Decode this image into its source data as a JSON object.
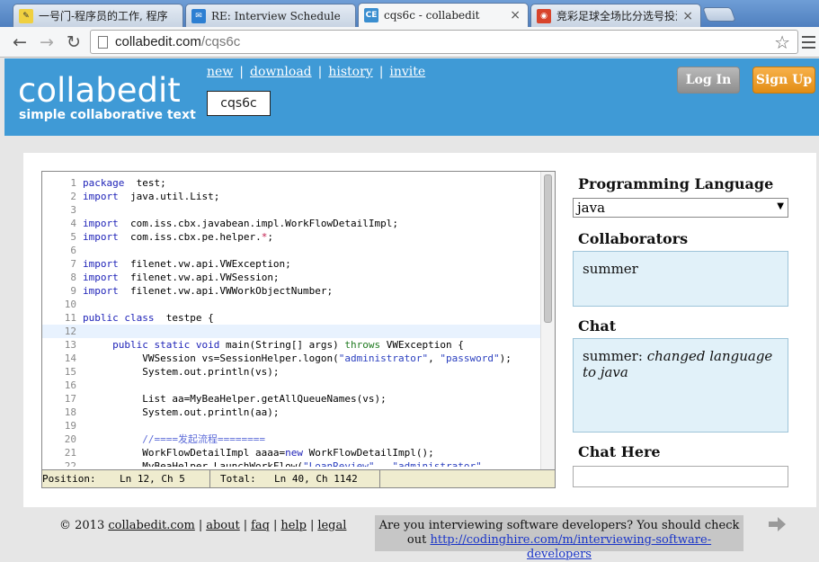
{
  "browser": {
    "tabs": [
      {
        "title": "一号门-程序员的工作, 程序",
        "active": false,
        "favicon": "edit-icon"
      },
      {
        "title": "RE: Interview Schedule",
        "active": false,
        "favicon": "mail-icon"
      },
      {
        "title": "cqs6c - collabedit",
        "active": true,
        "favicon": "CE"
      },
      {
        "title": "竞彩足球全场比分选号投注",
        "active": false,
        "favicon": "lottery-icon"
      }
    ],
    "tab_close_glyph": "×",
    "url_host": "collabedit.com",
    "url_path": "/cqs6c",
    "back_glyph": "←",
    "forward_glyph": "→",
    "reload_glyph": "↻",
    "star_glyph": "☆"
  },
  "site": {
    "logo": "collabedit",
    "tagline": "simple collaborative text",
    "nav": {
      "new": "new",
      "download": "download",
      "history": "history",
      "invite": "invite"
    },
    "nav_sep": "|",
    "doc_id": "cqs6c",
    "login": "Log In",
    "signup": "Sign Up"
  },
  "editor": {
    "status": {
      "position_label": "Position:",
      "position": "Ln 12, Ch 5",
      "total_label": "Total:",
      "total": "Ln 40, Ch 1142"
    },
    "highlighted_line": 12,
    "lines": [
      {
        "n": "1",
        "parts": [
          [
            "k",
            "package"
          ],
          [
            "",
            "  test;"
          ]
        ]
      },
      {
        "n": "2",
        "parts": [
          [
            "k",
            "import"
          ],
          [
            "",
            "  java.util.List;"
          ]
        ]
      },
      {
        "n": "3",
        "parts": []
      },
      {
        "n": "4",
        "parts": [
          [
            "k",
            "import"
          ],
          [
            "",
            "  com.iss.cbx.javabean.impl.WorkFlowDetailImpl;"
          ]
        ]
      },
      {
        "n": "5",
        "parts": [
          [
            "k",
            "import"
          ],
          [
            "",
            "  com.iss.cbx.pe.helper."
          ],
          [
            "o",
            "*"
          ],
          [
            "",
            ";"
          ]
        ]
      },
      {
        "n": "6",
        "parts": []
      },
      {
        "n": "7",
        "parts": [
          [
            "k",
            "import"
          ],
          [
            "",
            "  filenet.vw.api.VWException;"
          ]
        ]
      },
      {
        "n": "8",
        "parts": [
          [
            "k",
            "import"
          ],
          [
            "",
            "  filenet.vw.api.VWSession;"
          ]
        ]
      },
      {
        "n": "9",
        "parts": [
          [
            "k",
            "import"
          ],
          [
            "",
            "  filenet.vw.api.VWWorkObjectNumber;"
          ]
        ]
      },
      {
        "n": "10",
        "parts": []
      },
      {
        "n": "11",
        "parts": [
          [
            "k",
            "public class"
          ],
          [
            "",
            "  testpe {"
          ]
        ]
      },
      {
        "n": "12",
        "parts": [
          [
            "",
            "    "
          ]
        ]
      },
      {
        "n": "13",
        "parts": [
          [
            "",
            "     "
          ],
          [
            "k",
            "public static void"
          ],
          [
            "",
            " main(String[] args) "
          ],
          [
            "t",
            "throws"
          ],
          [
            "",
            " VWException {"
          ]
        ]
      },
      {
        "n": "14",
        "parts": [
          [
            "",
            "          VWSession vs=SessionHelper.logon("
          ],
          [
            "s",
            "\"administrator\""
          ],
          [
            "",
            ", "
          ],
          [
            "s",
            "\"password\""
          ],
          [
            "",
            ");"
          ]
        ]
      },
      {
        "n": "15",
        "parts": [
          [
            "",
            "          System.out.println(vs);"
          ]
        ]
      },
      {
        "n": "16",
        "parts": []
      },
      {
        "n": "17",
        "parts": [
          [
            "",
            "          List aa=MyBeaHelper.getAllQueueNames(vs);"
          ]
        ]
      },
      {
        "n": "18",
        "parts": [
          [
            "",
            "          System.out.println(aa);"
          ]
        ]
      },
      {
        "n": "19",
        "parts": []
      },
      {
        "n": "20",
        "parts": [
          [
            "c",
            "          //====发起流程========"
          ]
        ]
      },
      {
        "n": "21",
        "parts": [
          [
            "",
            "          WorkFlowDetailImpl aaaa="
          ],
          [
            "k",
            "new"
          ],
          [
            "",
            " WorkFlowDetailImpl();"
          ]
        ]
      },
      {
        "n": "22",
        "parts": [
          [
            "",
            "          MyBeaHelper.LaunchWorkFlow("
          ],
          [
            "s",
            "\"LoanReview\""
          ],
          [
            "",
            ",  "
          ],
          [
            "s",
            "\"administrator\""
          ]
        ]
      }
    ]
  },
  "sidebar": {
    "language_heading": "Programming Language",
    "language_value": "java",
    "select_arrow": "▼",
    "collaborators_heading": "Collaborators",
    "collaborators": [
      "summer"
    ],
    "chat_heading": "Chat",
    "chat_user": "summer:",
    "chat_text": "changed language to java",
    "chat_here_heading": "Chat Here"
  },
  "footer": {
    "copyright_prefix": "© 2013",
    "links": {
      "home": "collabedit.com",
      "about": "about",
      "faq": "faq",
      "help": "help",
      "legal": "legal"
    },
    "sep": "|",
    "promo_text": "Are you interviewing software developers? You should check out",
    "promo_link": "http://codinghire.com/m/interviewing-software-developers"
  },
  "colors": {
    "header_bg": "#3f9ad6",
    "signup": "#e9981f",
    "login": "#a0a0a0",
    "side_box": "#e1f1f9"
  }
}
